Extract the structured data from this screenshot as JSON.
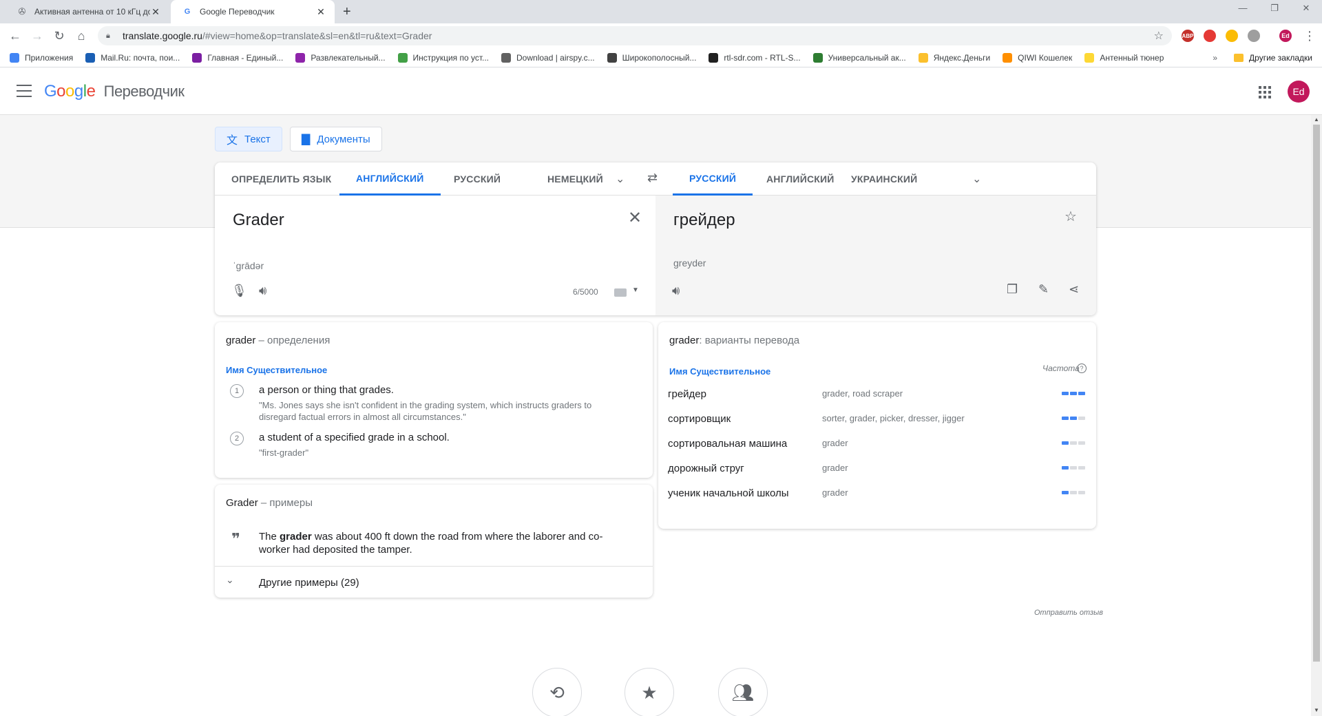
{
  "browser": {
    "tabs": [
      {
        "title": "Активная антенна от 10 кГц до"
      },
      {
        "title": "Google Переводчик"
      }
    ],
    "url_host": "translate.google.ru",
    "url_path": "/#view=home&op=translate&sl=en&tl=ru&text=Grader",
    "extensions": [
      {
        "label": "ABP",
        "color": "#c4302b"
      },
      {
        "label": "",
        "color": "#e53935"
      },
      {
        "label": "",
        "color": "#fbbc05"
      },
      {
        "label": "",
        "color": "#9e9e9e"
      },
      {
        "label": "Ed",
        "color": "#c2185b"
      }
    ],
    "bookmarks": [
      {
        "label": "Приложения",
        "color": "#4285f4"
      },
      {
        "label": "Mail.Ru: почта, пои...",
        "color": "#1a5fb4"
      },
      {
        "label": "Главная - Единый...",
        "color": "#7b1fa2"
      },
      {
        "label": "Развлекательный...",
        "color": "#8e24aa"
      },
      {
        "label": "Инструкция по уст...",
        "color": "#43a047"
      },
      {
        "label": "Download | airspy.c...",
        "color": "#616161"
      },
      {
        "label": "Широкополосный...",
        "color": "#424242"
      },
      {
        "label": "rtl-sdr.com - RTL-S...",
        "color": "#212121"
      },
      {
        "label": "Универсальный ак...",
        "color": "#2e7d32"
      },
      {
        "label": "Яндекс.Деньги",
        "color": "#fbc02d"
      },
      {
        "label": "QIWI Кошелек",
        "color": "#ff8f00"
      },
      {
        "label": "Антенный тюнер",
        "color": "#fdd835"
      }
    ],
    "bookmarks_more": "»",
    "other_bookmarks": "Другие закладки"
  },
  "app": {
    "logo_letters": [
      "G",
      "o",
      "o",
      "g",
      "l",
      "e"
    ],
    "product": "Переводчик",
    "avatar": "Ed"
  },
  "modes": {
    "text": "Текст",
    "documents": "Документы"
  },
  "languages": {
    "source": [
      "ОПРЕДЕЛИТЬ ЯЗЫК",
      "АНГЛИЙСКИЙ",
      "РУССКИЙ",
      "НЕМЕЦКИЙ"
    ],
    "target": [
      "РУССКИЙ",
      "АНГЛИЙСКИЙ",
      "УКРАИНСКИЙ"
    ]
  },
  "source": {
    "text": "Grader",
    "transliteration": "ˈgrādər",
    "counter": "6/5000"
  },
  "target": {
    "text": "грейдер",
    "transliteration": "greyder"
  },
  "definitions": {
    "word": "grader",
    "suffix": "– определения",
    "pos": "Имя Существительное",
    "items": [
      {
        "num": "1",
        "text": "a person or thing that grades.",
        "example": "\"Ms. Jones says she isn't confident in the grading system, which instructs graders to disregard factual errors in almost all circumstances.\""
      },
      {
        "num": "2",
        "text": "a student of a specified grade in a school.",
        "example": "\"first-grader\""
      }
    ]
  },
  "examples": {
    "word": "Grader",
    "suffix": "– примеры",
    "sentence_before": "The ",
    "sentence_bold": "grader",
    "sentence_after": " was about 400 ft down the road from where the laborer and co-worker had deposited the tamper.",
    "more": "Другие примеры (29)"
  },
  "translations": {
    "word": "grader",
    "suffix": ": варианты перевода",
    "pos": "Имя Существительное",
    "freq_label": "Частота",
    "rows": [
      {
        "word": "грейдер",
        "synonyms": "grader, road scraper",
        "freq": 3
      },
      {
        "word": "сортировщик",
        "synonyms": "sorter, grader, picker, dresser, jigger",
        "freq": 2
      },
      {
        "word": "сортировальная машина",
        "synonyms": "grader",
        "freq": 1
      },
      {
        "word": "дорожный струг",
        "synonyms": "grader",
        "freq": 1
      },
      {
        "word": "ученик начальной школы",
        "synonyms": "grader",
        "freq": 1
      }
    ]
  },
  "feedback": "Отправить отзыв",
  "colors": {
    "accent": "#1a73e8",
    "avatar": "#c2185b"
  }
}
